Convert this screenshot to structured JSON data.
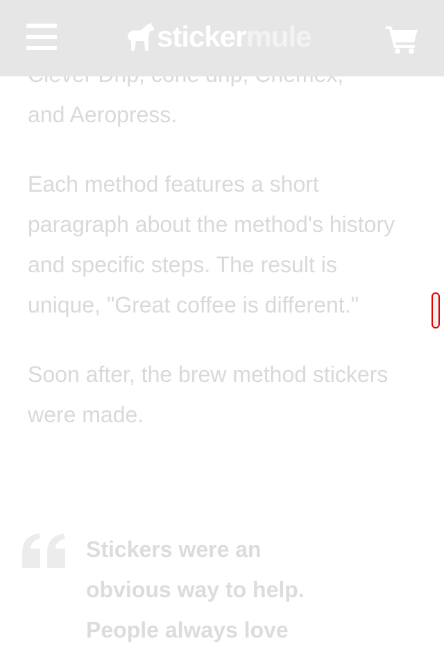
{
  "header": {
    "menu_icon": "hamburger-menu-icon",
    "logo": {
      "part1": "sticker",
      "part2": "mule",
      "icon": "mule-icon"
    },
    "cart_icon": "shopping-cart-icon",
    "background": "#e6e6e6"
  },
  "article": {
    "partial_line": "Clever Drip, cone drip, Chemex,",
    "paragraph1_end": "and Aeropress.",
    "paragraph2": "Each method features a short paragraph about the method's history and specific steps. The result is unique, \"Great coffee is different.\"",
    "paragraph3": "Soon after, the brew method stickers were made."
  },
  "quote": {
    "icon": "quote-mark-icon",
    "text": "Stickers were an obvious way to help. People always love"
  },
  "colors": {
    "text_faded": "#d9d9d9",
    "handle_border": "#e00000"
  }
}
